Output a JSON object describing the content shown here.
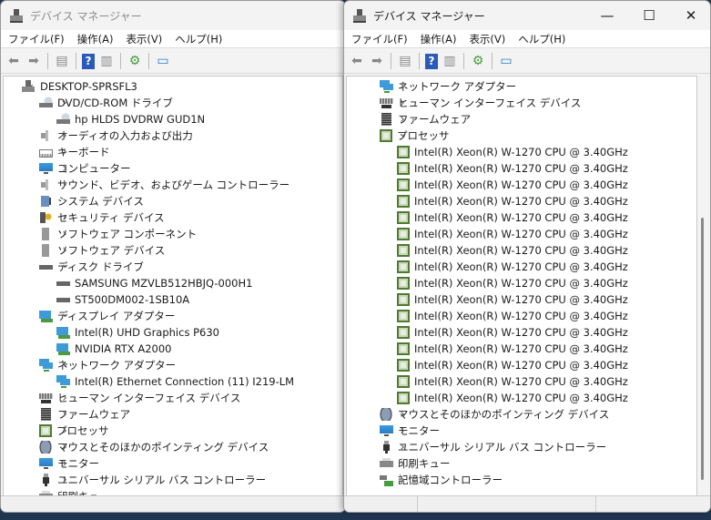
{
  "left": {
    "title": "デバイス マネージャー",
    "menu": [
      "ファイル(F)",
      "操作(A)",
      "表示(V)",
      "ヘルプ(H)"
    ],
    "tree": [
      {
        "lvl": 0,
        "exp": "open",
        "icon": "computer",
        "label": "DESKTOP-SPRSFL3"
      },
      {
        "lvl": 1,
        "exp": "open",
        "icon": "dvd",
        "label": "DVD/CD-ROM ドライブ"
      },
      {
        "lvl": 2,
        "icon": "dvd",
        "label": "hp HLDS DVDRW  GUD1N"
      },
      {
        "lvl": 1,
        "exp": "closed",
        "icon": "audio",
        "label": "オーディオの入力および出力"
      },
      {
        "lvl": 1,
        "exp": "closed",
        "icon": "keyboard",
        "label": "キーボード"
      },
      {
        "lvl": 1,
        "exp": "closed",
        "icon": "monitor",
        "label": "コンピューター"
      },
      {
        "lvl": 1,
        "exp": "closed",
        "icon": "audio",
        "label": "サウンド、ビデオ、およびゲーム コントローラー"
      },
      {
        "lvl": 1,
        "exp": "closed",
        "icon": "system",
        "label": "システム デバイス"
      },
      {
        "lvl": 1,
        "exp": "closed",
        "icon": "security",
        "label": "セキュリティ デバイス"
      },
      {
        "lvl": 1,
        "exp": "closed",
        "icon": "software",
        "label": "ソフトウェア コンポーネント"
      },
      {
        "lvl": 1,
        "exp": "closed",
        "icon": "software",
        "label": "ソフトウェア デバイス"
      },
      {
        "lvl": 1,
        "exp": "open",
        "icon": "disk",
        "label": "ディスク ドライブ"
      },
      {
        "lvl": 2,
        "icon": "disk",
        "label": "SAMSUNG MZVLB512HBJQ-000H1"
      },
      {
        "lvl": 2,
        "icon": "disk",
        "label": "ST500DM002-1SB10A"
      },
      {
        "lvl": 1,
        "exp": "open",
        "icon": "display",
        "label": "ディスプレイ アダプター"
      },
      {
        "lvl": 2,
        "icon": "display",
        "label": "Intel(R) UHD Graphics P630"
      },
      {
        "lvl": 2,
        "icon": "display",
        "label": "NVIDIA RTX A2000"
      },
      {
        "lvl": 1,
        "exp": "open",
        "icon": "network",
        "label": "ネットワーク アダプター"
      },
      {
        "lvl": 2,
        "icon": "network",
        "label": "Intel(R) Ethernet Connection (11) I219-LM"
      },
      {
        "lvl": 1,
        "exp": "closed",
        "icon": "hid",
        "label": "ヒューマン インターフェイス デバイス"
      },
      {
        "lvl": 1,
        "exp": "closed",
        "icon": "firmware",
        "label": "ファームウェア"
      },
      {
        "lvl": 1,
        "exp": "closed",
        "icon": "cpu",
        "label": "プロセッサ"
      },
      {
        "lvl": 1,
        "exp": "closed",
        "icon": "mouse",
        "label": "マウスとそのほかのポインティング デバイス"
      },
      {
        "lvl": 1,
        "exp": "closed",
        "icon": "monitor",
        "label": "モニター"
      },
      {
        "lvl": 1,
        "exp": "closed",
        "icon": "usb",
        "label": "ユニバーサル シリアル バス コントローラー"
      },
      {
        "lvl": 1,
        "exp": "closed",
        "icon": "printer",
        "label": "印刷キュー"
      }
    ]
  },
  "right": {
    "title": "デバイス マネージャー",
    "menu": [
      "ファイル(F)",
      "操作(A)",
      "表示(V)",
      "ヘルプ(H)"
    ],
    "tree": [
      {
        "lvl": 1,
        "exp": "closed",
        "icon": "network",
        "label": "ネットワーク アダプター"
      },
      {
        "lvl": 1,
        "exp": "closed",
        "icon": "hid",
        "label": "ヒューマン インターフェイス デバイス"
      },
      {
        "lvl": 1,
        "exp": "closed",
        "icon": "firmware",
        "label": "ファームウェア"
      },
      {
        "lvl": 1,
        "exp": "open",
        "icon": "cpu",
        "label": "プロセッサ"
      },
      {
        "lvl": 2,
        "icon": "cpu",
        "label": "Intel(R) Xeon(R) W-1270 CPU @ 3.40GHz"
      },
      {
        "lvl": 2,
        "icon": "cpu",
        "label": "Intel(R) Xeon(R) W-1270 CPU @ 3.40GHz"
      },
      {
        "lvl": 2,
        "icon": "cpu",
        "label": "Intel(R) Xeon(R) W-1270 CPU @ 3.40GHz"
      },
      {
        "lvl": 2,
        "icon": "cpu",
        "label": "Intel(R) Xeon(R) W-1270 CPU @ 3.40GHz"
      },
      {
        "lvl": 2,
        "icon": "cpu",
        "label": "Intel(R) Xeon(R) W-1270 CPU @ 3.40GHz"
      },
      {
        "lvl": 2,
        "icon": "cpu",
        "label": "Intel(R) Xeon(R) W-1270 CPU @ 3.40GHz"
      },
      {
        "lvl": 2,
        "icon": "cpu",
        "label": "Intel(R) Xeon(R) W-1270 CPU @ 3.40GHz"
      },
      {
        "lvl": 2,
        "icon": "cpu",
        "label": "Intel(R) Xeon(R) W-1270 CPU @ 3.40GHz"
      },
      {
        "lvl": 2,
        "icon": "cpu",
        "label": "Intel(R) Xeon(R) W-1270 CPU @ 3.40GHz"
      },
      {
        "lvl": 2,
        "icon": "cpu",
        "label": "Intel(R) Xeon(R) W-1270 CPU @ 3.40GHz"
      },
      {
        "lvl": 2,
        "icon": "cpu",
        "label": "Intel(R) Xeon(R) W-1270 CPU @ 3.40GHz"
      },
      {
        "lvl": 2,
        "icon": "cpu",
        "label": "Intel(R) Xeon(R) W-1270 CPU @ 3.40GHz"
      },
      {
        "lvl": 2,
        "icon": "cpu",
        "label": "Intel(R) Xeon(R) W-1270 CPU @ 3.40GHz"
      },
      {
        "lvl": 2,
        "icon": "cpu",
        "label": "Intel(R) Xeon(R) W-1270 CPU @ 3.40GHz"
      },
      {
        "lvl": 2,
        "icon": "cpu",
        "label": "Intel(R) Xeon(R) W-1270 CPU @ 3.40GHz"
      },
      {
        "lvl": 2,
        "icon": "cpu",
        "label": "Intel(R) Xeon(R) W-1270 CPU @ 3.40GHz"
      },
      {
        "lvl": 1,
        "exp": "closed",
        "icon": "mouse",
        "label": "マウスとそのほかのポインティング デバイス"
      },
      {
        "lvl": 1,
        "exp": "closed",
        "icon": "monitor",
        "label": "モニター"
      },
      {
        "lvl": 1,
        "exp": "closed",
        "icon": "usb",
        "label": "ユニバーサル シリアル バス コントローラー"
      },
      {
        "lvl": 1,
        "exp": "closed",
        "icon": "printer",
        "label": "印刷キュー"
      },
      {
        "lvl": 1,
        "exp": "closed",
        "icon": "storage",
        "label": "記憶域コントローラー"
      }
    ]
  },
  "toolbar_icons": [
    "back-icon",
    "forward-icon",
    "console-tree-icon",
    "help-icon",
    "action-pane-icon",
    "update-driver-icon",
    "scan-hardware-icon"
  ],
  "window_controls": {
    "minimize": "—",
    "maximize": "☐",
    "close": "✕"
  }
}
